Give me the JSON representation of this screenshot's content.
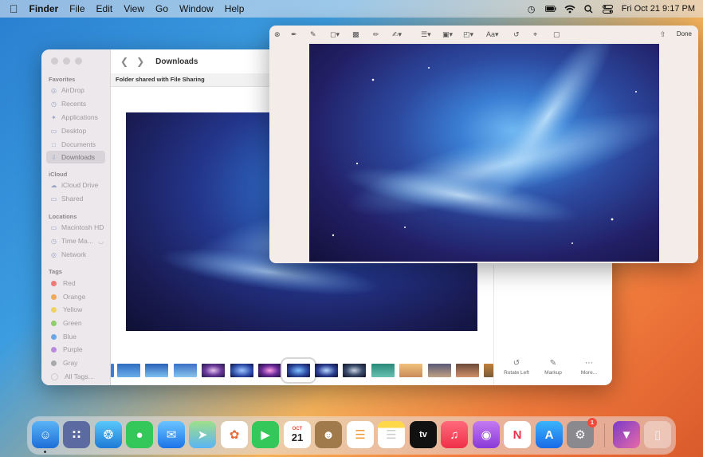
{
  "menubar": {
    "app_name": "Finder",
    "items": [
      "File",
      "Edit",
      "View",
      "Go",
      "Window",
      "Help"
    ],
    "datetime": "Fri Oct 21  9:17 PM"
  },
  "finder": {
    "title": "Downloads",
    "banner": "Folder shared with File Sharing",
    "sidebar": {
      "favorites_label": "Favorites",
      "favorites": [
        "AirDrop",
        "Recents",
        "Applications",
        "Desktop",
        "Documents",
        "Downloads"
      ],
      "icloud_label": "iCloud",
      "icloud": [
        "iCloud Drive",
        "Shared"
      ],
      "locations_label": "Locations",
      "locations": [
        "Macintosh HD",
        "Time Ma...",
        "Network"
      ],
      "tags_label": "Tags",
      "tags": [
        {
          "name": "Red",
          "color": "#f07a78"
        },
        {
          "name": "Orange",
          "color": "#f0a85a"
        },
        {
          "name": "Yellow",
          "color": "#efd35e"
        },
        {
          "name": "Green",
          "color": "#8fcf6a"
        },
        {
          "name": "Blue",
          "color": "#6aa7e8"
        },
        {
          "name": "Purple",
          "color": "#b98ae0"
        },
        {
          "name": "Gray",
          "color": "#a8a8a8"
        }
      ],
      "all_tags": "All Tags..."
    },
    "actions": {
      "rotate_left": "Rotate Left",
      "markup": "Markup",
      "more": "More..."
    }
  },
  "markup": {
    "done_label": "Done"
  },
  "dock": {
    "calendar_month": "OCT",
    "calendar_day": "21",
    "tv_label": "tv",
    "settings_badge": "1"
  }
}
